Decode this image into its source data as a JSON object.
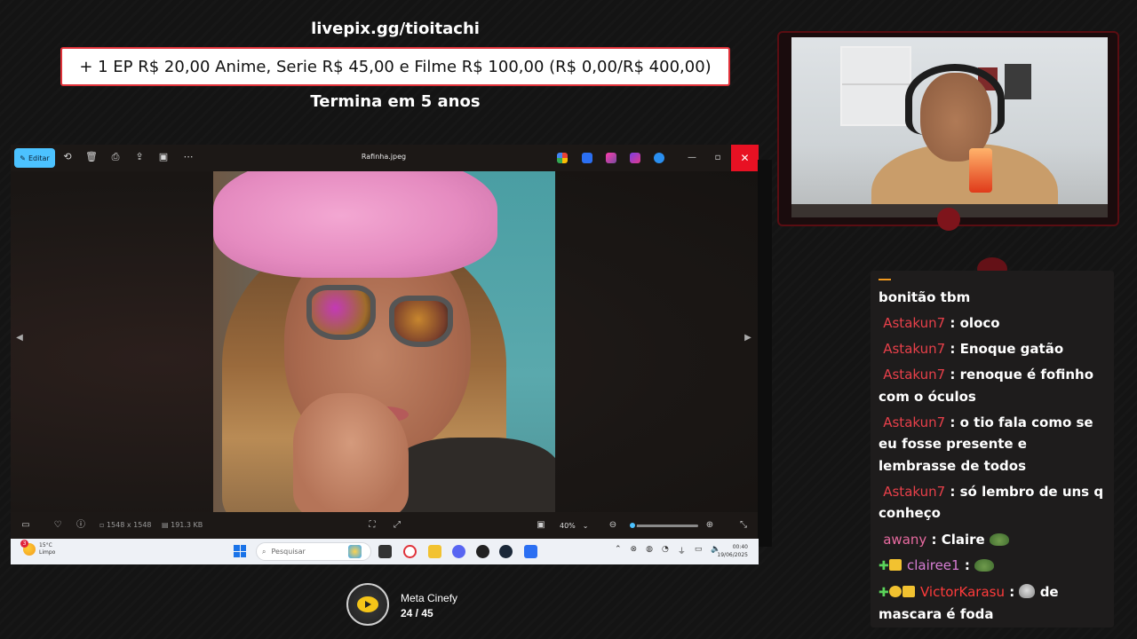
{
  "overlay": {
    "livepix_url": "livepix.gg/tioitachi",
    "goal_text": "+ 1 EP R$ 20,00 Anime, Serie R$ 45,00 e Filme R$ 100,00 (R$ 0,00/R$ 400,00)",
    "goal_ends": "Termina em 5 anos"
  },
  "photo_viewer": {
    "edit_label": "Editar",
    "file_name": "Rafinha.jpeg",
    "dimensions": "1548 x 1548",
    "file_size": "191.3 KB",
    "zoom_label": "40%",
    "zoom_level": 0.05,
    "toolbar_icons": [
      "rotate-icon",
      "delete-icon",
      "print-icon",
      "share-icon",
      "slideshow-icon",
      "more-icon"
    ],
    "close_glyph": "✕"
  },
  "taskbar": {
    "weather_temp": "15°C",
    "weather_desc": "Limpo",
    "weather_badge": "3",
    "search_placeholder": "Pesquisar",
    "clock_time": "00:40",
    "clock_date": "19/06/2025"
  },
  "chat": {
    "messages": [
      {
        "text": "bonitão tbm"
      },
      {
        "user": "Astakun7",
        "text": "oloco"
      },
      {
        "user": "Astakun7",
        "text": "Enoque gatão"
      },
      {
        "user": "Astakun7",
        "text": "renoque é fofinho com o óculos"
      },
      {
        "user": "Astakun7",
        "text": "o tio fala como se eu fosse presente e lembrasse de todos"
      },
      {
        "user": "Astakun7",
        "text": "só lembro de uns q conheço"
      },
      {
        "user": "awany",
        "text": "Claire"
      },
      {
        "user": "clairee1",
        "text": ""
      },
      {
        "user": "VictorKarasu",
        "text": "de mascara é foda"
      }
    ]
  },
  "cinefy": {
    "title": "Meta Cinefy",
    "count": "24 / 45"
  },
  "colors": {
    "accent_blue": "#4cc2ff",
    "close_red": "#e81123",
    "chat_user": "#e8404a",
    "goal_border": "#e0323a"
  }
}
